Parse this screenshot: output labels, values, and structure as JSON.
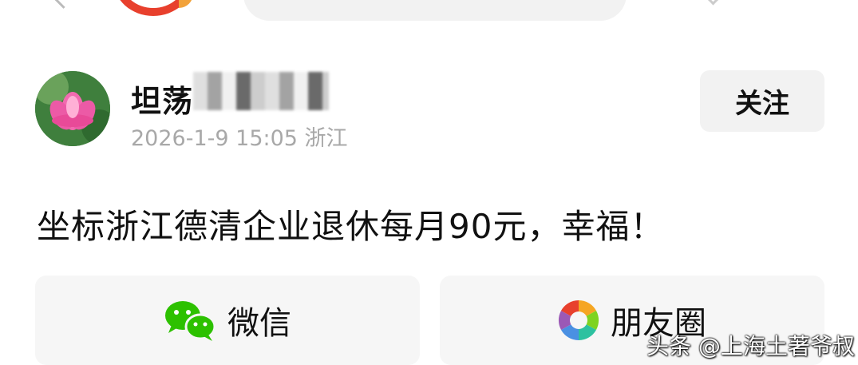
{
  "header": {
    "username": "坦荡",
    "date": "2026-1-9 15:05",
    "location": "浙江",
    "follow_label": "关注"
  },
  "post": {
    "text": "坐标浙江德清企业退休每月90元，幸福！"
  },
  "share": {
    "wechat_label": "微信",
    "moments_label": "朋友圈"
  },
  "watermark": "头条 @上海土著爷叔",
  "icons": {
    "avatar": "lotus-avatar-icon",
    "wechat": "wechat-icon",
    "moments": "moments-shutter-icon"
  },
  "colors": {
    "wechat_green": "#2dc100",
    "meta_gray": "#a8a8a8",
    "button_bg": "#f2f2f2"
  }
}
